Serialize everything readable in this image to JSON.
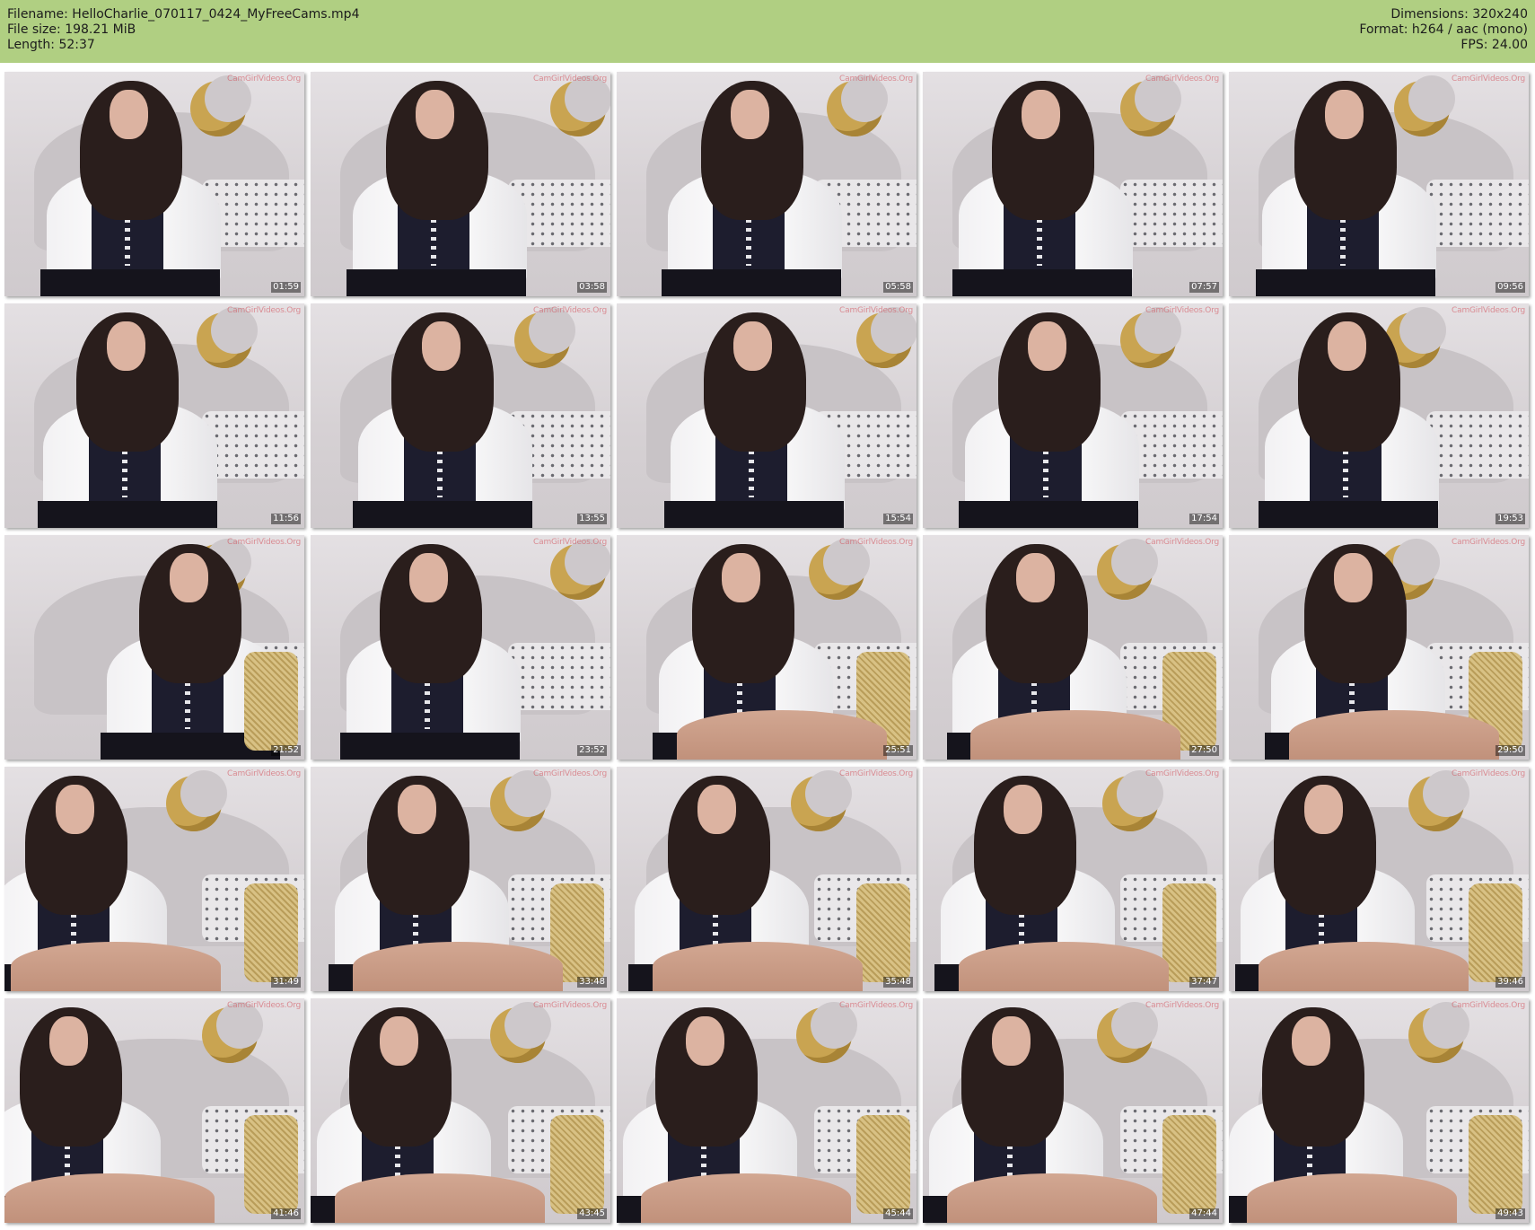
{
  "header": {
    "filename": "Filename: HelloCharlie_070117_0424_MyFreeCams.mp4",
    "file_size": "File size: 198.21 MiB",
    "length": "Length: 52:37",
    "dimensions": "Dimensions: 320x240",
    "format": "Format: h264 / aac (mono)",
    "fps": "FPS: 24.00"
  },
  "watermark": "CamGirlVideos.Org",
  "timestamps": [
    "01:59",
    "03:58",
    "05:58",
    "07:57",
    "09:56",
    "11:56",
    "13:55",
    "15:54",
    "17:54",
    "19:53",
    "21:52",
    "23:52",
    "25:51",
    "27:50",
    "29:50",
    "31:49",
    "33:48",
    "35:48",
    "37:47",
    "39:46",
    "41:46",
    "43:45",
    "45:44",
    "47:44",
    "49:43"
  ],
  "colors": {
    "header_bg": "#b0cf82"
  }
}
